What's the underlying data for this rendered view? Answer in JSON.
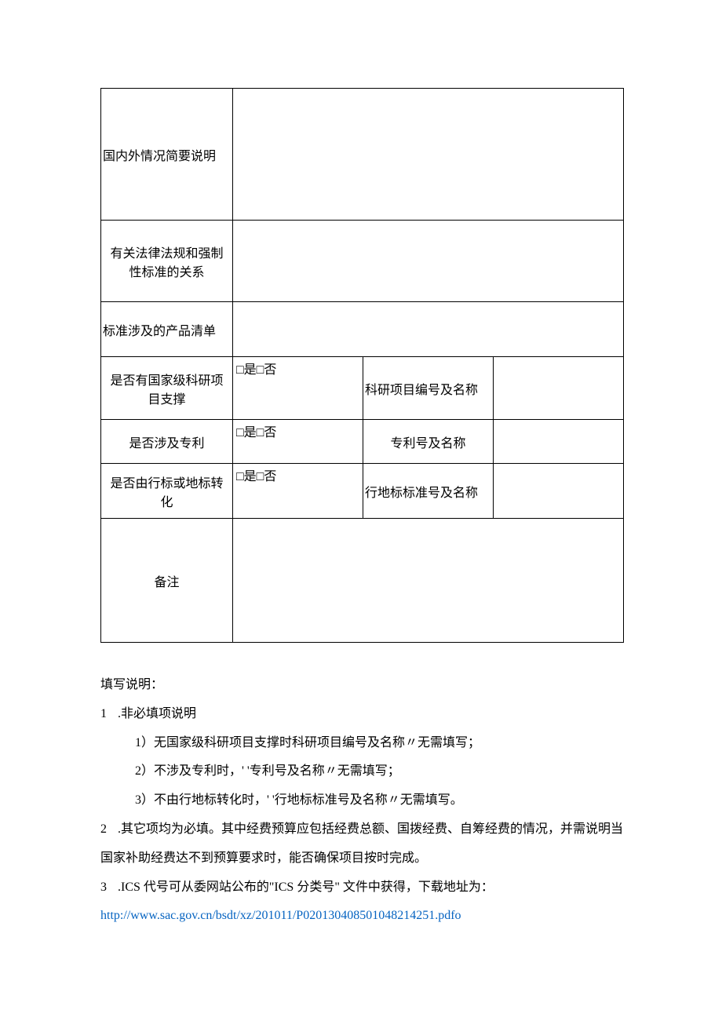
{
  "table": {
    "row1_label": "国内外情况简要说明",
    "row2_label": "有关法律法规和强制性标准的关系",
    "row3_label": "标准涉及的产品清单",
    "row4_label": "是否有国家级科研项目支撑",
    "row4_value": "□是□否",
    "row4_label2": "科研项目编号及名称",
    "row5_label": "是否涉及专利",
    "row5_value": "□是□否",
    "row5_label2": "专利号及名称",
    "row6_label": "是否由行标或地标转化",
    "row6_value": "□是□否",
    "row6_label2": "行地标标准号及名称",
    "row7_label": "备注"
  },
  "instructions": {
    "heading": "填写说明：",
    "item1_num": "1",
    "item1_text": " .非必填项说明",
    "item1_sub1": "1）无国家级科研项目支撑时科研项目编号及名称〃无需填写；",
    "item1_sub2": "2）不涉及专利时，' '专利号及名称〃无需填写；",
    "item1_sub3": "3）不由行地标转化时，' '行地标标准号及名称〃无需填写。",
    "item2_num": "2",
    "item2_text": " .其它项均为必填。其中经费预算应包括经费总额、国拨经费、自筹经费的情况，并需说明当",
    "item2_text2": "国家补助经费达不到预算要求时，能否确保项目按时完成。",
    "item3_num": "3",
    "item3_text": " .ICS 代号可从委网站公布的\"ICS 分类号\" 文件中获得，下载地址为：",
    "item3_link": "http://www.sac.gov.cn/bsdt/xz/201011/P020130408501048214251.pdfo"
  }
}
